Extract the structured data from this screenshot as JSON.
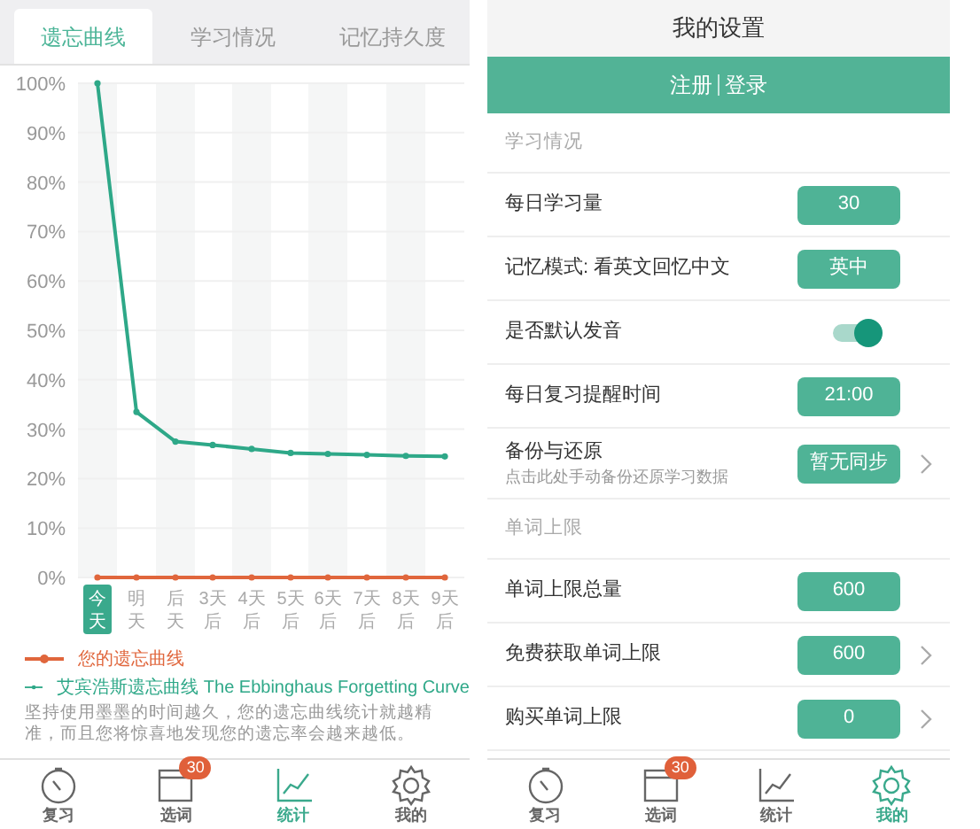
{
  "left_screen": {
    "tabs": [
      {
        "label": "遗忘曲线",
        "selected": true
      },
      {
        "label": "学习情况",
        "selected": false
      },
      {
        "label": "记忆持久度",
        "selected": false
      }
    ],
    "chart": {
      "first_category_highlighted": true,
      "chart_data": {
        "type": "line",
        "categories": [
          "今天",
          "明天",
          "后天",
          "3天后",
          "4天后",
          "5天后",
          "6天后",
          "7天后",
          "8天后",
          "9天后"
        ],
        "yticks": [
          {
            "value": 0,
            "label": "0%"
          },
          {
            "value": 10,
            "label": "10%"
          },
          {
            "value": 20,
            "label": "20%"
          },
          {
            "value": 30,
            "label": "30%"
          },
          {
            "value": 40,
            "label": "40%"
          },
          {
            "value": 50,
            "label": "50%"
          },
          {
            "value": 60,
            "label": "60%"
          },
          {
            "value": 70,
            "label": "70%"
          },
          {
            "value": 80,
            "label": "80%"
          },
          {
            "value": 90,
            "label": "90%"
          },
          {
            "value": 100,
            "label": "100%"
          }
        ],
        "ylim": [
          0,
          100
        ],
        "grid": true,
        "series": [
          {
            "name": "您的遗忘曲线",
            "color": "#e0663c",
            "marker": true,
            "values": [
              0,
              0,
              0,
              0,
              0,
              0,
              0,
              0,
              0,
              0
            ]
          },
          {
            "name": "艾宾浩斯遗忘曲线 The Ebbinghaus Forgetting Curve",
            "color": "#2ea888",
            "marker": true,
            "values": [
              100,
              33.5,
              27.5,
              26.8,
              26,
              25.2,
              25,
              24.8,
              24.6,
              24.5
            ]
          }
        ]
      }
    },
    "note": "坚持使用墨墨的时间越久，您的遗忘曲线统计就越精准，而且您将惊喜地发现您的遗忘率会越来越低。",
    "nav": [
      {
        "label": "复习",
        "selected": false
      },
      {
        "label": "选词",
        "selected": false,
        "badge": "30"
      },
      {
        "label": "统计",
        "selected": true
      },
      {
        "label": "我的",
        "selected": false
      }
    ]
  },
  "right_screen": {
    "title": "我的设置",
    "login_bar": {
      "register": "注册",
      "login": "登录"
    },
    "rows": [
      {
        "kind": "section",
        "label": "学习情况"
      },
      {
        "kind": "value",
        "label": "每日学习量",
        "value": "30",
        "arrow": false
      },
      {
        "kind": "value",
        "label": "记忆模式: 看英文回忆中文",
        "value": "英中",
        "arrow": false
      },
      {
        "kind": "toggle",
        "label": "是否默认发音",
        "on": true
      },
      {
        "kind": "value",
        "label": "每日复习提醒时间",
        "value": "21:00",
        "arrow": false
      },
      {
        "kind": "value",
        "label": "备份与还原",
        "sublabel": "点击此处手动备份还原学习数据",
        "value": "暂无同步",
        "arrow": true
      },
      {
        "kind": "section",
        "label": "单词上限"
      },
      {
        "kind": "value",
        "label": "单词上限总量",
        "value": "600",
        "arrow": false
      },
      {
        "kind": "value",
        "label": "免费获取单词上限",
        "value": "600",
        "arrow": true
      },
      {
        "kind": "value",
        "label": "购买单词上限",
        "value": "0",
        "arrow": true
      }
    ],
    "nav": [
      {
        "label": "复习",
        "selected": false
      },
      {
        "label": "选词",
        "selected": false,
        "badge": "30"
      },
      {
        "label": "统计",
        "selected": false
      },
      {
        "label": "我的",
        "selected": true
      }
    ]
  }
}
